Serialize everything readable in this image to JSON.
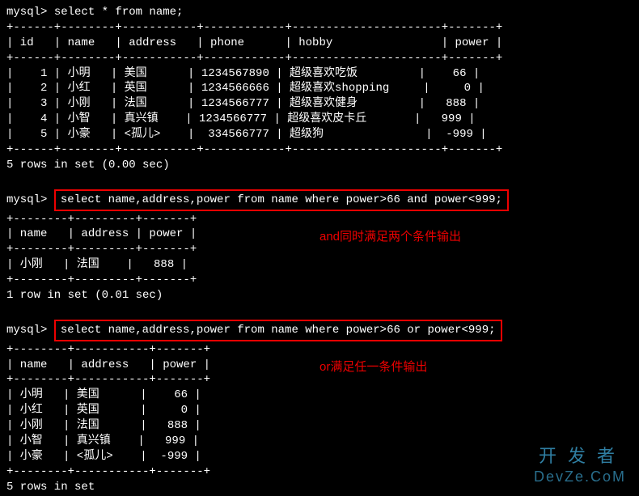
{
  "prompt1": {
    "prefix": "mysql> ",
    "command": "select * from name;"
  },
  "table1": {
    "border_top": "+------+--------+-----------+------------+----------------------+-------+",
    "header": "| id   | name   | address   | phone      | hobby                | power |",
    "border_mid": "+------+--------+-----------+------------+----------------------+-------+",
    "row1": "|    1 | 小明   | 美国      | 1234567890 | 超级喜欢吃饭         |    66 |",
    "row2": "|    2 | 小红   | 英国      | 1234566666 | 超级喜欢shopping     |     0 |",
    "row3": "|    3 | 小刚   | 法国      | 1234566777 | 超级喜欢健身         |   888 |",
    "row4": "|    4 | 小智   | 真兴镇    | 1234566777 | 超级喜欢皮卡丘       |   999 |",
    "row5": "|    5 | 小豪   | <孤儿>    |  334566777 | 超级狗               |  -999 |",
    "border_bot": "+------+--------+-----------+------------+----------------------+-------+",
    "footer": "5 rows in set (0.00 sec)"
  },
  "prompt2": {
    "prefix": "mysql> ",
    "command": "select name,address,power from name where power>66 and power<999;"
  },
  "table2": {
    "border_top": "+--------+---------+-------+",
    "header": "| name   | address | power |",
    "border_mid": "+--------+---------+-------+",
    "row1": "| 小刚   | 法国    |   888 |",
    "border_bot": "+--------+---------+-------+",
    "footer": "1 row in set (0.01 sec)"
  },
  "annotation1": "and同时满足两个条件输出",
  "prompt3": {
    "prefix": "mysql> ",
    "command": "select name,address,power from name where power>66 or power<999;"
  },
  "table3": {
    "border_top": "+--------+-----------+-------+",
    "header": "| name   | address   | power |",
    "border_mid": "+--------+-----------+-------+",
    "row1": "| 小明   | 美国      |    66 |",
    "row2": "| 小红   | 英国      |     0 |",
    "row3": "| 小刚   | 法国      |   888 |",
    "row4": "| 小智   | 真兴镇    |   999 |",
    "row5": "| 小豪   | <孤儿>    |  -999 |",
    "border_bot": "+--------+-----------+-------+",
    "footer": "5 rows in set"
  },
  "annotation2": "or满足任一条件输出",
  "watermark": {
    "cn": "开发者",
    "en": "DevZe.CoM"
  }
}
